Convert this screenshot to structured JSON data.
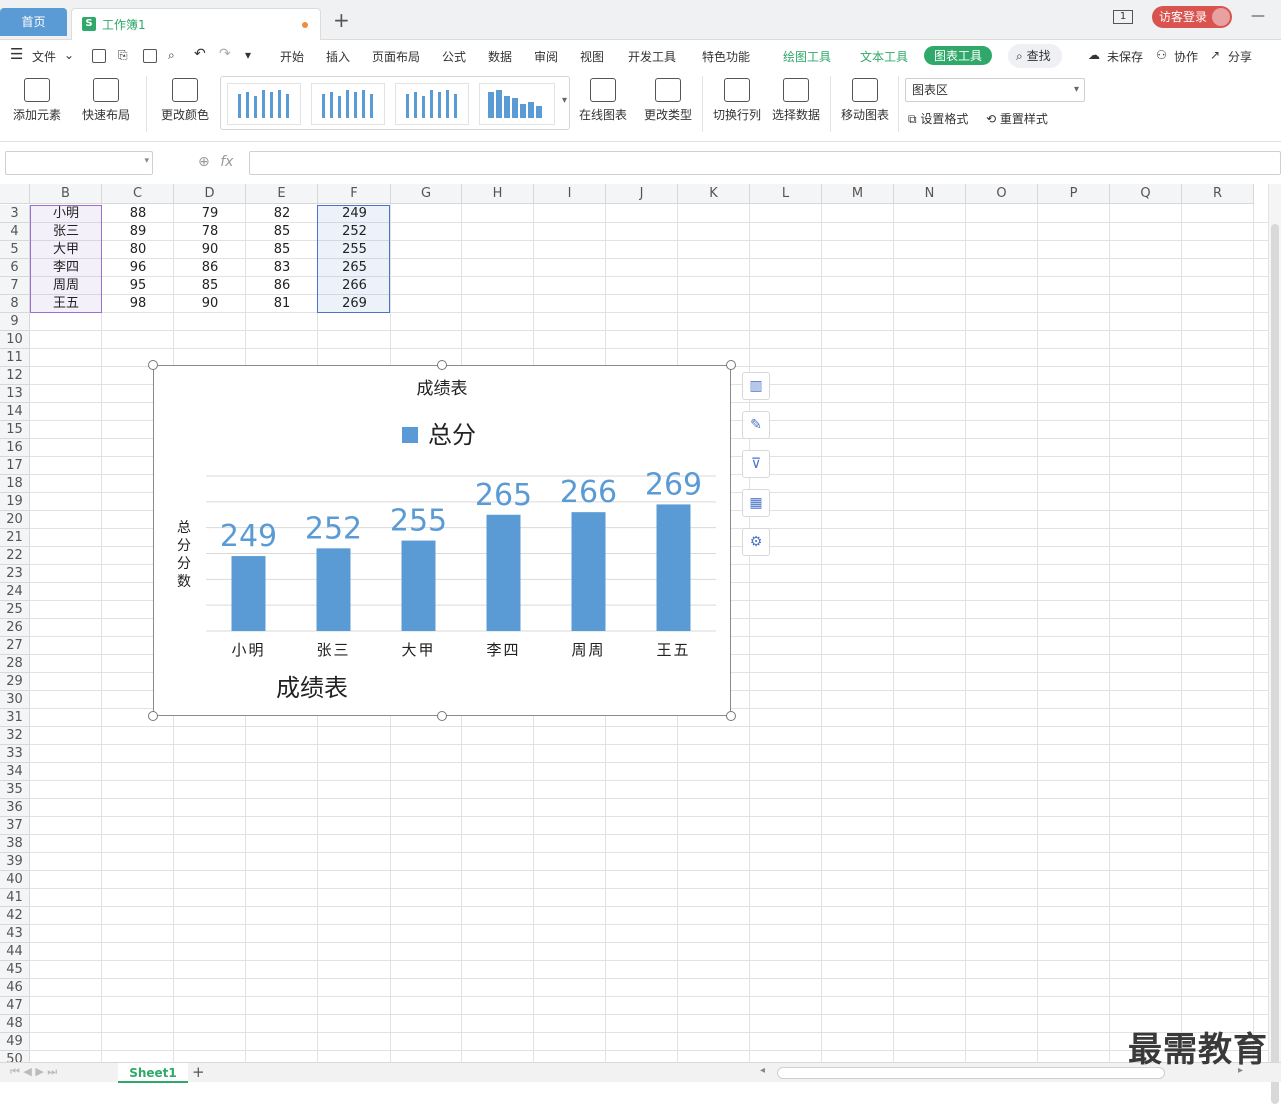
{
  "tabs": {
    "home": "首页",
    "document": "工作簿1",
    "new_tab": "+"
  },
  "window": {
    "page_indicator": "1",
    "login": "访客登录",
    "minimize": "—"
  },
  "menu": {
    "file": "文件",
    "items": [
      "开始",
      "插入",
      "页面布局",
      "公式",
      "数据",
      "审阅",
      "视图",
      "开发工具",
      "特色功能"
    ],
    "tool_tabs": [
      "绘图工具",
      "文本工具"
    ],
    "active_tool_tab": "图表工具",
    "search": "查找",
    "right": [
      "未保存",
      "协作",
      "分享"
    ]
  },
  "ribbon": {
    "add_element": "添加元素",
    "quick_layout": "快速布局",
    "change_color": "更改颜色",
    "online_chart": "在线图表",
    "change_type": "更改类型",
    "switch_rowcol": "切换行列",
    "select_data": "选择数据",
    "move_chart": "移动图表",
    "chart_area_select": "图表区",
    "set_format": "设置格式",
    "reset_style": "重置样式"
  },
  "formula": {
    "fx": "fx",
    "name_box": "",
    "value": ""
  },
  "grid": {
    "columns": [
      "B",
      "C",
      "D",
      "E",
      "F",
      "G",
      "H",
      "I",
      "J",
      "K",
      "L",
      "M",
      "N",
      "O",
      "P",
      "Q",
      "R"
    ],
    "first_row": 3,
    "last_row": 50,
    "rows": [
      [
        "小明",
        "88",
        "79",
        "82",
        "249"
      ],
      [
        "张三",
        "89",
        "78",
        "85",
        "252"
      ],
      [
        "大甲",
        "80",
        "90",
        "85",
        "255"
      ],
      [
        "李四",
        "96",
        "86",
        "83",
        "265"
      ],
      [
        "周周",
        "95",
        "85",
        "86",
        "266"
      ],
      [
        "王五",
        "98",
        "90",
        "81",
        "269"
      ]
    ]
  },
  "chart_data": {
    "type": "bar",
    "title": "成绩表",
    "bottom_title": "成绩表",
    "ylabel": "总分分数",
    "xlabel": "",
    "categories": [
      "小明",
      "张三",
      "大甲",
      "李四",
      "周周",
      "王五"
    ],
    "series": [
      {
        "name": "总分",
        "values": [
          249,
          252,
          255,
          265,
          266,
          269
        ],
        "color": "#5b9bd5"
      }
    ],
    "ylim": [
      220,
      280
    ],
    "grid": true,
    "legend": "top",
    "data_labels": true
  },
  "chart_tools": [
    "chart-elements-icon",
    "chart-style-icon",
    "chart-filter-icon",
    "chart-online-icon",
    "chart-settings-icon"
  ],
  "sheet": {
    "active_tab": "Sheet1",
    "add": "+"
  },
  "watermark": "最需教育",
  "colors": {
    "accent": "#2fa869",
    "bar": "#5b9bd5",
    "home_tab": "#5b9bd5",
    "login": "#d9534f"
  }
}
